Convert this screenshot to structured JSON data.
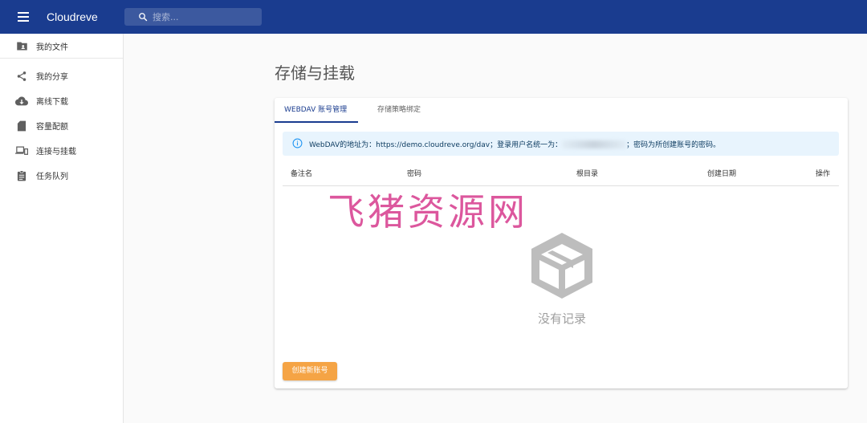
{
  "app": {
    "title": "Cloudreve"
  },
  "search": {
    "placeholder": "搜索..."
  },
  "sidebar": {
    "items": [
      {
        "label": "我的文件"
      },
      {
        "label": "我的分享"
      },
      {
        "label": "离线下载"
      },
      {
        "label": "容量配额"
      },
      {
        "label": "连接与挂载"
      },
      {
        "label": "任务队列"
      }
    ]
  },
  "main": {
    "title": "存储与挂载",
    "tabs": [
      {
        "label": "WEBDAV 账号管理",
        "active": true
      },
      {
        "label": "存储策略绑定",
        "active": false
      }
    ],
    "alert": {
      "prefix": "WebDAV的地址为：https://demo.cloudreve.org/dav；登录用户名统一为：",
      "suffix": "；密码为所创建账号的密码。"
    },
    "table": {
      "headers": [
        "备注名",
        "密码",
        "根目录",
        "创建日期",
        "操作"
      ]
    },
    "empty_text": "没有记录",
    "create_button": "创建新账号"
  },
  "watermark": {
    "text": "飞猪资源网"
  },
  "colors": {
    "primary": "#1a3c8f",
    "secondary": "#f5a445",
    "alert_bg": "#e8f4fd"
  }
}
